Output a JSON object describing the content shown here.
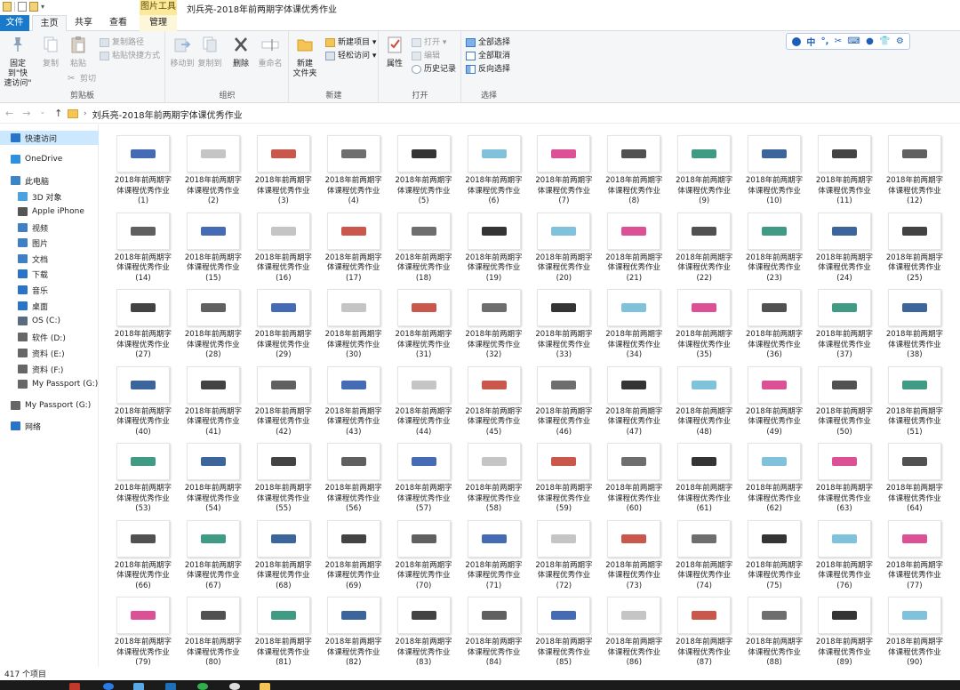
{
  "window": {
    "title": "刘兵亮-2018年前两期字体课优秀作业",
    "context_tab": "图片工具"
  },
  "tabs": {
    "file": "文件",
    "home": "主页",
    "share": "共享",
    "view": "查看",
    "manage": "管理"
  },
  "ribbon": {
    "clipboard": {
      "label": "剪贴板",
      "pin": "固定到\"快\n速访问\"",
      "copy": "复制",
      "paste": "粘贴",
      "copy_path": "复制路径",
      "paste_shortcut": "粘贴快捷方式",
      "cut": "剪切"
    },
    "organize": {
      "label": "组织",
      "move_to": "移动到",
      "copy_to": "复制到",
      "delete": "删除",
      "rename": "重命名"
    },
    "new": {
      "label": "新建",
      "new_folder": "新建\n文件夹",
      "new_item": "新建项目 ▾",
      "easy_access": "轻松访问 ▾"
    },
    "open": {
      "label": "打开",
      "properties": "属性",
      "open": "打开 ▾",
      "edit": "编辑",
      "history": "历史记录"
    },
    "select": {
      "label": "选择",
      "select_all": "全部选择",
      "select_none": "全部取消",
      "invert": "反向选择"
    }
  },
  "ime": [
    "中",
    "°,",
    "✂",
    "⌨",
    "👕",
    "⚙"
  ],
  "addressbar": {
    "path": "刘兵亮-2018年前两期字体课优秀作业"
  },
  "nav": {
    "items": [
      {
        "label": "快速访问",
        "color": "#2a74c8"
      },
      {
        "label": "OneDrive",
        "color": "#2f8fe0"
      },
      {
        "label": "此电脑",
        "color": "#3c86c8"
      },
      {
        "label": "3D 对象",
        "color": "#4aa3df"
      },
      {
        "label": "Apple iPhone",
        "color": "#555555"
      },
      {
        "label": "视频",
        "color": "#3f7fc2"
      },
      {
        "label": "图片",
        "color": "#3f7fc2"
      },
      {
        "label": "文档",
        "color": "#3f7fc2"
      },
      {
        "label": "下载",
        "color": "#2a74c8"
      },
      {
        "label": "音乐",
        "color": "#2a74c8"
      },
      {
        "label": "桌面",
        "color": "#2a74c8"
      },
      {
        "label": "OS (C:)",
        "color": "#5a6b7d"
      },
      {
        "label": "软件 (D:)",
        "color": "#666666"
      },
      {
        "label": "资料 (E:)",
        "color": "#666666"
      },
      {
        "label": "资料 (F:)",
        "color": "#666666"
      },
      {
        "label": "My Passport (G:)",
        "color": "#666666"
      },
      {
        "label": "My Passport (G:)",
        "color": "#666666"
      },
      {
        "label": "网络",
        "color": "#2a74c8"
      }
    ]
  },
  "files": {
    "name_line1": "2018年前两期字",
    "name_line2": "体课程优秀作业",
    "numbers": [
      [
        1,
        2,
        3,
        4,
        5,
        6,
        7,
        8,
        9,
        10,
        11,
        12
      ],
      [
        14,
        15,
        16,
        17,
        18,
        19,
        20,
        21,
        22,
        23,
        24,
        25
      ],
      [
        27,
        28,
        29,
        30,
        31,
        32,
        33,
        34,
        35,
        36,
        37,
        38
      ],
      [
        40,
        41,
        42,
        43,
        44,
        45,
        46,
        47,
        48,
        49,
        50,
        51
      ],
      [
        53,
        54,
        55,
        56,
        57,
        58,
        59,
        60,
        61,
        62,
        63,
        64
      ],
      [
        66,
        67,
        68,
        69,
        70,
        71,
        72,
        73,
        74,
        75,
        76,
        77
      ],
      [
        79,
        80,
        81,
        82,
        83,
        84,
        85,
        86,
        87,
        88,
        89,
        90
      ]
    ],
    "thumb_colors": [
      "#2451a8",
      "#333333",
      "#c0392b",
      "#1a4a8a",
      "#111111",
      "#444444",
      "#d63384",
      "#bbbbbb",
      "#1f8a70",
      "#555555",
      "#222222",
      "#6ab7d6"
    ]
  },
  "status": {
    "count": "417 个项目"
  }
}
